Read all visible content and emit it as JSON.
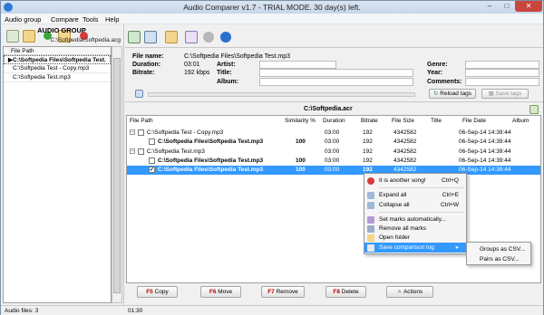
{
  "window": {
    "title": "Audio Comparer v1.7 - TRIAL MODE. 30 day(s) left."
  },
  "menu": [
    "Audio group",
    "Compare",
    "Tools",
    "Help"
  ],
  "left_panel": {
    "title": "AUDIO GROUP",
    "group_path": "C:\\Softpedia\\Softpedia.acg",
    "column_header": "File Path",
    "files": [
      "C:\\Softpedia Files\\Softpedia Test.",
      "C:\\Softpedia Test - Copy.mp3",
      "C:\\Softpedia Test.mp3"
    ]
  },
  "file_info": {
    "file_name_label": "File name:",
    "file_name": "C:\\Softpedia Files\\Softpedia Test.mp3",
    "duration_label": "Duration:",
    "duration": "03:01",
    "bitrate_label": "Bitrate:",
    "bitrate": "192 kbps",
    "artist_label": "Artist:",
    "title_label": "Title:",
    "album_label": "Album:",
    "genre_label": "Genre:",
    "year_label": "Year:",
    "comments_label": "Comments:",
    "reload_tags": "Reload tags",
    "save_tags": "Save tags"
  },
  "results": {
    "path": "C:\\Softpedia.acr",
    "headers": [
      "File Path",
      "Similarity %",
      "Duration",
      "Bitrate",
      "File Size",
      "Title",
      "File Date",
      "Album"
    ],
    "rows": [
      {
        "path": "C:\\Softpedia Test - Copy.mp3",
        "similarity": "",
        "duration": "03:00",
        "bitrate": "192",
        "size": "4342582",
        "date": "06-Sep-14 14:39:44",
        "level": 0
      },
      {
        "path": "C:\\Softpedia Files\\Softpedia Test.mp3",
        "similarity": "100",
        "duration": "03:00",
        "bitrate": "192",
        "size": "4342582",
        "date": "06-Sep-14 14:39:44",
        "level": 1
      },
      {
        "path": "C:\\Softpedia Test.mp3",
        "similarity": "",
        "duration": "03:00",
        "bitrate": "192",
        "size": "4342582",
        "date": "06-Sep-14 14:39:44",
        "level": 0
      },
      {
        "path": "C:\\Softpedia Files\\Softpedia Test.mp3",
        "similarity": "100",
        "duration": "03:00",
        "bitrate": "192",
        "size": "4342582",
        "date": "06-Sep-14 14:39:44",
        "level": 1
      },
      {
        "path": "C:\\Softpedia Files\\Softpedia Test.mp3",
        "similarity": "100",
        "duration": "03:00",
        "bitrate": "192",
        "size": "4342582",
        "date": "06-Sep-14 14:39:44",
        "level": 1,
        "selected": true,
        "checked": true
      }
    ]
  },
  "context_menu": {
    "items": [
      {
        "label": "It is another song!",
        "shortcut": "Ctrl+Q"
      },
      {
        "label": "Expand all",
        "shortcut": "Ctrl+E"
      },
      {
        "label": "Collapse all",
        "shortcut": "Ctrl+W"
      },
      {
        "label": "Set marks automatically...",
        "shortcut": ""
      },
      {
        "label": "Remove all marks",
        "shortcut": ""
      },
      {
        "label": "Open folder",
        "shortcut": ""
      },
      {
        "label": "Save comparison log",
        "shortcut": ""
      }
    ],
    "submenu": [
      "Groups as CSV...",
      "Pairs as CSV..."
    ]
  },
  "buttons": {
    "copy_key": "F5",
    "copy": "Copy",
    "move_key": "F6",
    "move": "Move",
    "remove_key": "F7",
    "remove": "Remove",
    "delete_key": "F8",
    "delete": "Delete",
    "actions": "Actions"
  },
  "status": {
    "audio_files": "Audio files: 3",
    "time": "01:30"
  },
  "colors": {
    "selection": "#3399ff",
    "close_button": "#c9463d",
    "key_red": "#c00000"
  }
}
